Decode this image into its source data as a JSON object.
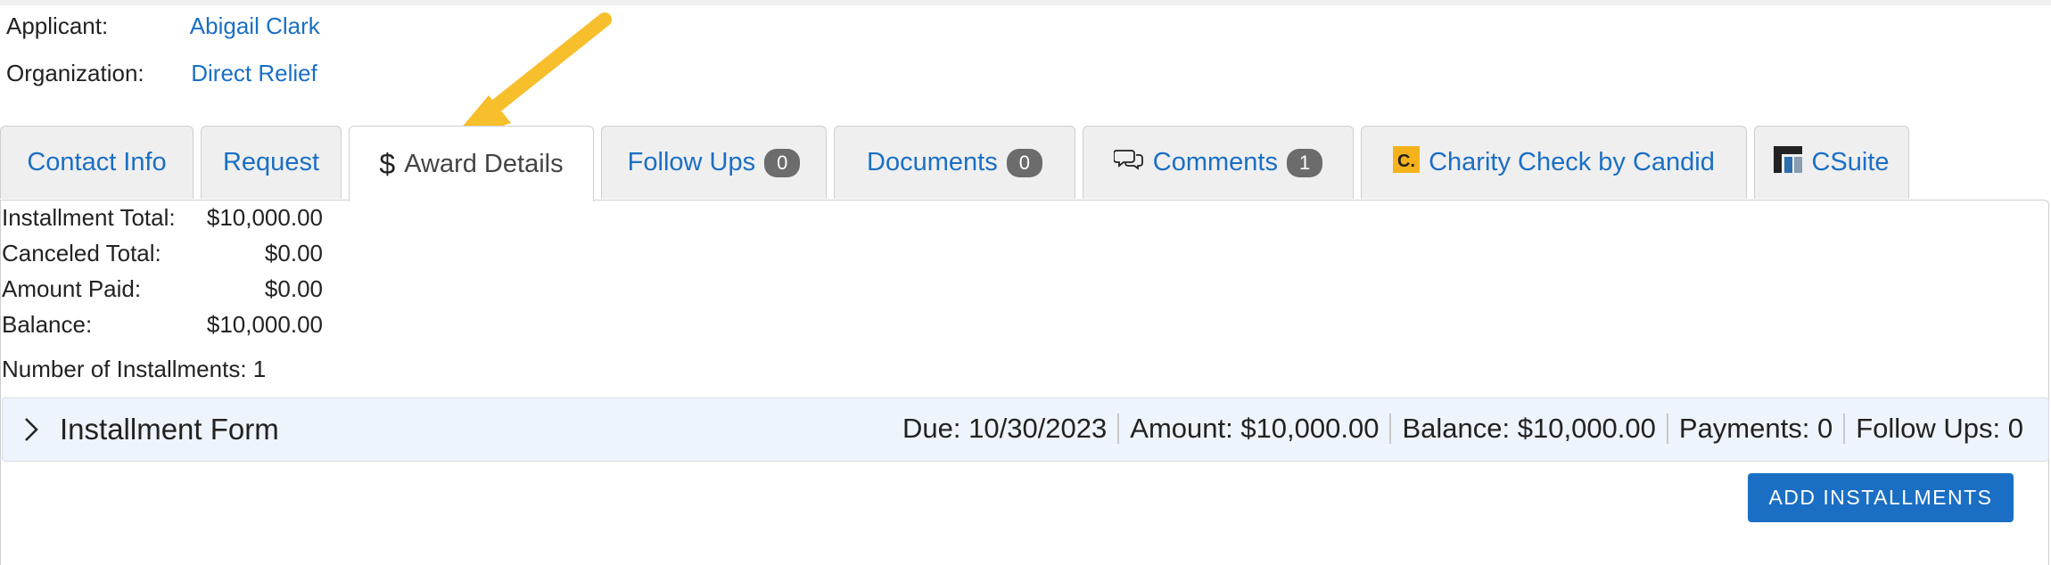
{
  "applicant": {
    "label": "Applicant:",
    "value": "Abigail Clark"
  },
  "organization": {
    "label": "Organization:",
    "value": "Direct Relief"
  },
  "tabs": [
    {
      "label": "Contact Info"
    },
    {
      "label": "Request"
    },
    {
      "label": "Award Details",
      "icon": "dollar-icon",
      "active": true
    },
    {
      "label": "Follow Ups",
      "badge": "0"
    },
    {
      "label": "Documents",
      "badge": "0"
    },
    {
      "label": "Comments",
      "badge": "1",
      "icon": "comments-icon"
    },
    {
      "label": "Charity Check by Candid",
      "icon": "candid-icon"
    },
    {
      "label": "CSuite",
      "icon": "csuite-icon"
    }
  ],
  "summary": [
    {
      "label": "Installment Total:",
      "value": "$10,000.00"
    },
    {
      "label": "Canceled Total:",
      "value": "$0.00"
    },
    {
      "label": "Amount Paid:",
      "value": "$0.00"
    },
    {
      "label": "Balance:",
      "value": "$10,000.00"
    }
  ],
  "installments_count": "Number of Installments: 1",
  "installment_form": {
    "title": "Installment Form",
    "due": "Due: 10/30/2023",
    "amount": "Amount: $10,000.00",
    "balance": "Balance: $10,000.00",
    "payments": "Payments: 0",
    "follow_ups": "Follow Ups: 0"
  },
  "add_installments_label": "ADD INSTALLMENTS",
  "colors": {
    "link": "#1a6fc4",
    "button": "#1a6fc4",
    "arrow": "#f6bf2b",
    "badge": "#6c6c6c"
  }
}
